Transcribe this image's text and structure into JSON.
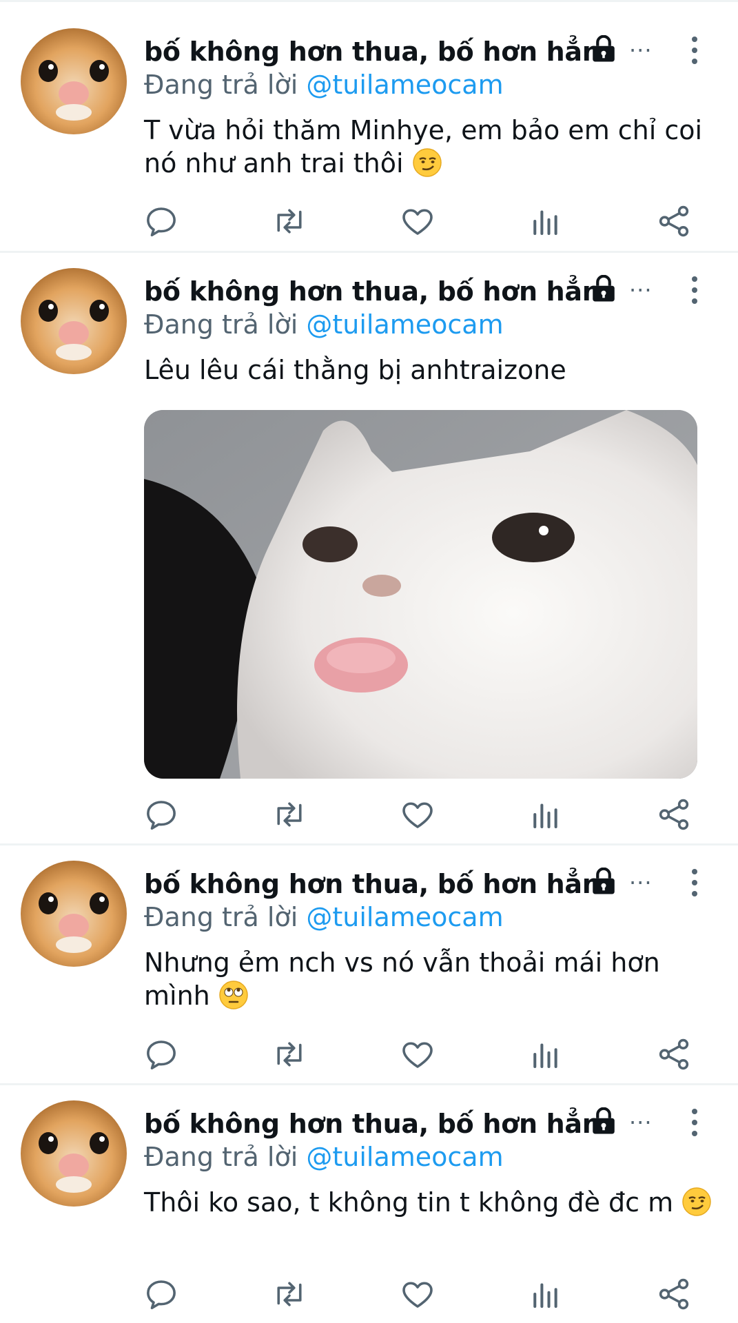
{
  "tweets": [
    {
      "display_name": "bố không hơn thua, bố hơn hẳn",
      "reply_prefix": "Đang trả lời",
      "reply_handle": "@tuilameocam",
      "text": "T vừa hỏi thăm Minhye, em bảo em chỉ coi nó như anh trai thôi",
      "emoji": "smirking-face",
      "has_media": false
    },
    {
      "display_name": "bố không hơn thua, bố hơn hẳn",
      "reply_prefix": "Đang trả lời",
      "reply_handle": "@tuilameocam",
      "text": "Lêu lêu cái thằng bị anhtraizone",
      "emoji": "",
      "has_media": true,
      "media_description_icon": "cat-tongue-photo"
    },
    {
      "display_name": "bố không hơn thua, bố hơn hẳn",
      "reply_prefix": "Đang trả lời",
      "reply_handle": "@tuilameocam",
      "text": "Nhưng ẻm nch vs nó vẫn thoải mái hơn mình",
      "emoji": "face-with-rolling-eyes",
      "has_media": false
    },
    {
      "display_name": "bố không hơn thua, bố hơn hẳn",
      "reply_prefix": "Đang trả lời",
      "reply_handle": "@tuilameocam",
      "text": "Thôi ko sao, t không tin t không đè đc m",
      "emoji": "smirking-face",
      "has_media": false
    }
  ],
  "icons": {
    "lock": "lock-icon",
    "more_horizontal": "more-horizontal-icon",
    "more_vertical": "more-vertical-icon",
    "reply": "reply-icon",
    "retweet": "retweet-icon",
    "like": "heart-icon",
    "views": "analytics-icon",
    "share": "share-icon"
  },
  "colors": {
    "text": "#0f1419",
    "secondary": "#536471",
    "link": "#1d9bf0",
    "divider": "#eff3f4"
  }
}
